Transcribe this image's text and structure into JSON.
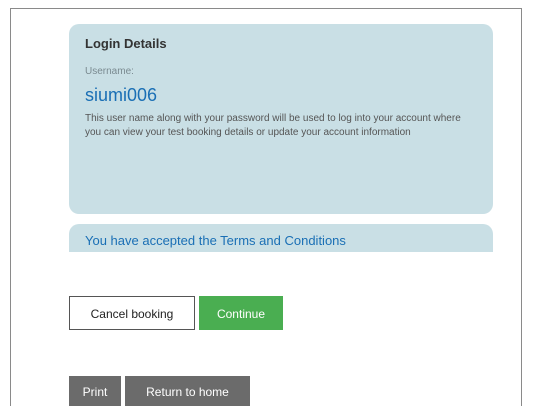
{
  "login_details": {
    "title": "Login Details",
    "username_label": "Username:",
    "username_value": "siumi006",
    "description": "This user name along with your password will be used to log into your account where you can view your test booking details or update your account information"
  },
  "terms": {
    "text": "You have accepted the Terms and Conditions"
  },
  "actions": {
    "cancel_label": "Cancel booking",
    "continue_label": "Continue"
  },
  "footer": {
    "print_label": "Print",
    "home_label": "Return to home"
  },
  "colors": {
    "panel_bg": "#c9dfe5",
    "link_blue": "#1a6fb5",
    "continue_green": "#4aae51",
    "footer_grey": "#6b6b6b"
  }
}
